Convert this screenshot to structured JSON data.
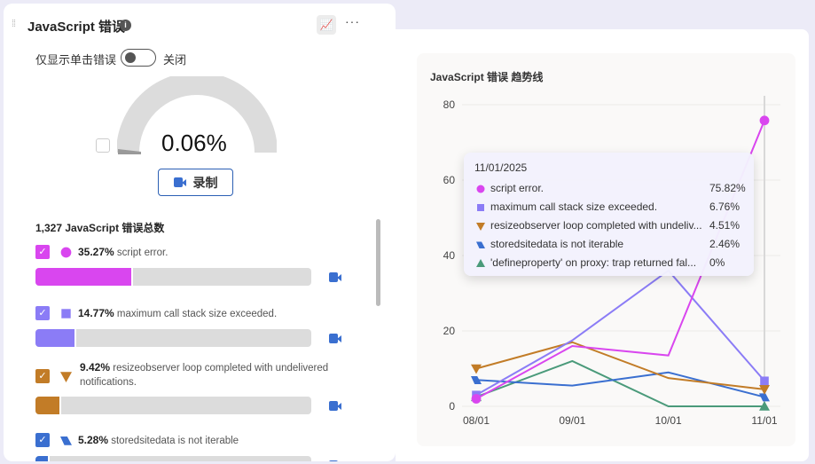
{
  "widget": {
    "title": "JavaScript 错误",
    "toggle_label": "仅显示单击错误",
    "toggle_state": "关闭",
    "gauge_value": "0.06%",
    "gauge_fraction": 0.0006,
    "record_label": "录制",
    "total_label": "1,327 JavaScript 错误总数"
  },
  "errors": [
    {
      "pct": "35.27%",
      "value": 35.27,
      "name": "script error.",
      "color": "#d946ef",
      "marker": "circle"
    },
    {
      "pct": "14.77%",
      "value": 14.77,
      "name": "maximum call stack size exceeded.",
      "color": "#8b7cf6",
      "marker": "square"
    },
    {
      "pct": "9.42%",
      "value": 9.42,
      "name": "resizeobserver loop completed with undelivered notifications.",
      "color": "#c27c27",
      "marker": "triangle-down"
    },
    {
      "pct": "5.28%",
      "value": 5.28,
      "name": "storedsitedata is not iterable",
      "color": "#3a6fd0",
      "marker": "parallelogram"
    }
  ],
  "tooltip": {
    "date": "11/01/2025",
    "rows": [
      {
        "name": "script error.",
        "value": "75.82%"
      },
      {
        "name": "maximum call stack size exceeded.",
        "value": "6.76%"
      },
      {
        "name": "resizeobserver loop completed with undeliv...",
        "value": "4.51%"
      },
      {
        "name": "storedsitedata is not iterable",
        "value": "2.46%"
      },
      {
        "name": "'defineproperty' on proxy: trap returned fal...",
        "value": "0%"
      }
    ]
  },
  "chart_data": {
    "type": "line",
    "title": "JavaScript 错误 趋势线",
    "categories": [
      "08/01",
      "09/01",
      "10/01",
      "11/01"
    ],
    "ylim": [
      0,
      80
    ],
    "yticks": [
      "0",
      "20",
      "40",
      "60",
      "80"
    ],
    "series": [
      {
        "name": "script error.",
        "color": "#d946ef",
        "marker": "circle",
        "values": [
          2,
          16,
          13.5,
          75.82
        ]
      },
      {
        "name": "maximum call stack size exceeded.",
        "color": "#8b7cf6",
        "marker": "square",
        "values": [
          3,
          17.5,
          36,
          6.76
        ]
      },
      {
        "name": "resizeobserver loop completed with undelivered notifications.",
        "color": "#c27c27",
        "marker": "triangle-down",
        "values": [
          10,
          17,
          7.5,
          4.51
        ]
      },
      {
        "name": "storedsitedata is not iterable",
        "color": "#3a6fd0",
        "marker": "parallelogram",
        "values": [
          7,
          5.5,
          9,
          2.46
        ]
      },
      {
        "name": "'defineproperty' on proxy: trap returned falsish",
        "color": "#4a9a7a",
        "marker": "triangle-up",
        "values": [
          2.5,
          12,
          0,
          0
        ]
      }
    ]
  }
}
